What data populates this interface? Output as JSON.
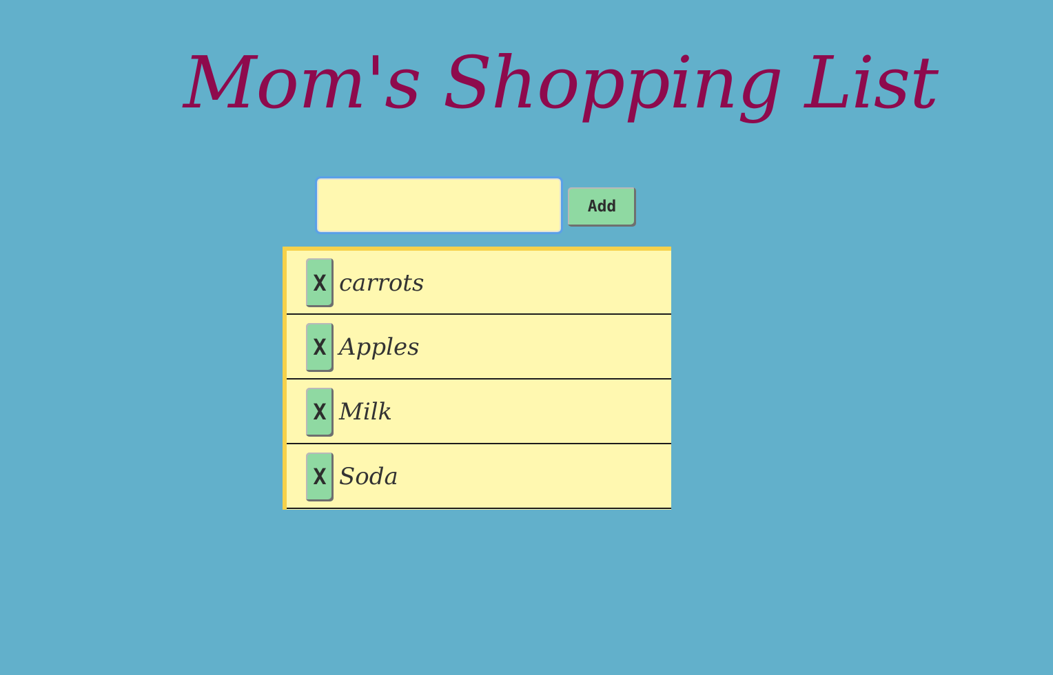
{
  "page": {
    "title": "Mom's Shopping List"
  },
  "form": {
    "input_value": "",
    "input_placeholder": "",
    "add_label": "Add"
  },
  "list": {
    "items": [
      {
        "label": "carrots",
        "remove_label": "X"
      },
      {
        "label": "Apples",
        "remove_label": "X"
      },
      {
        "label": "Milk",
        "remove_label": "X"
      },
      {
        "label": "Soda",
        "remove_label": "X"
      }
    ]
  },
  "colors": {
    "background": "#62b0cb",
    "title": "#8e0a4d",
    "note_paper": "#fff8b0",
    "note_edge": "#f6d14a",
    "button": "#8fd9a2",
    "focus_ring": "#5aa0e8"
  }
}
